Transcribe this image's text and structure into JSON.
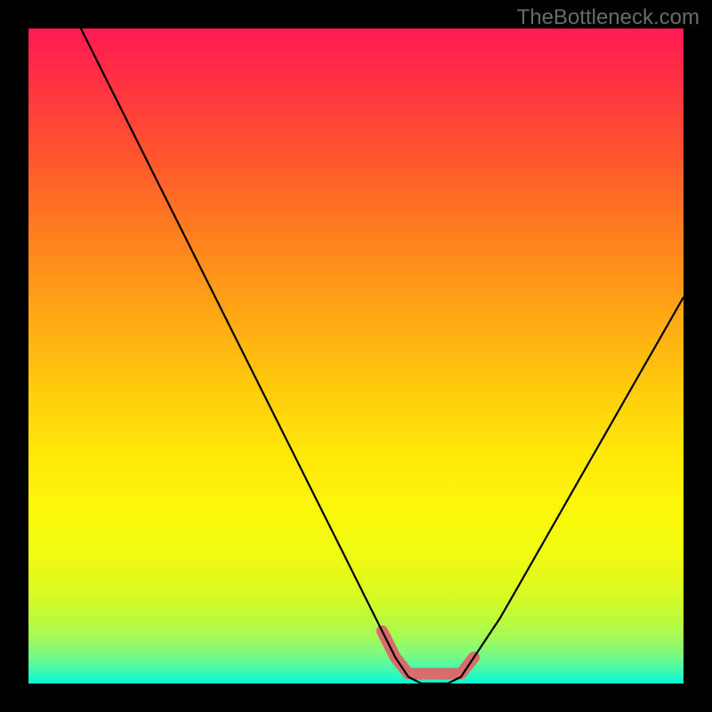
{
  "watermark": "TheBottleneck.com",
  "chart_data": {
    "type": "line",
    "title": "",
    "xlabel": "",
    "ylabel": "",
    "xlim": [
      0,
      100
    ],
    "ylim": [
      0,
      100
    ],
    "series": [
      {
        "name": "bottleneck-curve",
        "x": [
          8,
          12,
          16,
          20,
          24,
          28,
          32,
          36,
          40,
          44,
          48,
          52,
          54,
          56,
          58,
          60,
          62,
          64,
          66,
          68,
          72,
          76,
          80,
          84,
          88,
          92,
          96,
          100
        ],
        "y": [
          100,
          92,
          84,
          76,
          68,
          60,
          52,
          44,
          36,
          28,
          20,
          12,
          8,
          4,
          1,
          0,
          0,
          0,
          1,
          4,
          10,
          17,
          24,
          31,
          38,
          45,
          52,
          59
        ]
      }
    ],
    "marker": {
      "name": "optimal-zone-marker",
      "x_start": 54,
      "x_end": 69,
      "y": 1.5,
      "color": "#d86c6c"
    },
    "gradient": {
      "top_color": "#ff1a52",
      "mid_colors": [
        "#ff7a20",
        "#ffcb0c",
        "#fbf80a"
      ],
      "bottom_color": "#06fad2"
    }
  }
}
